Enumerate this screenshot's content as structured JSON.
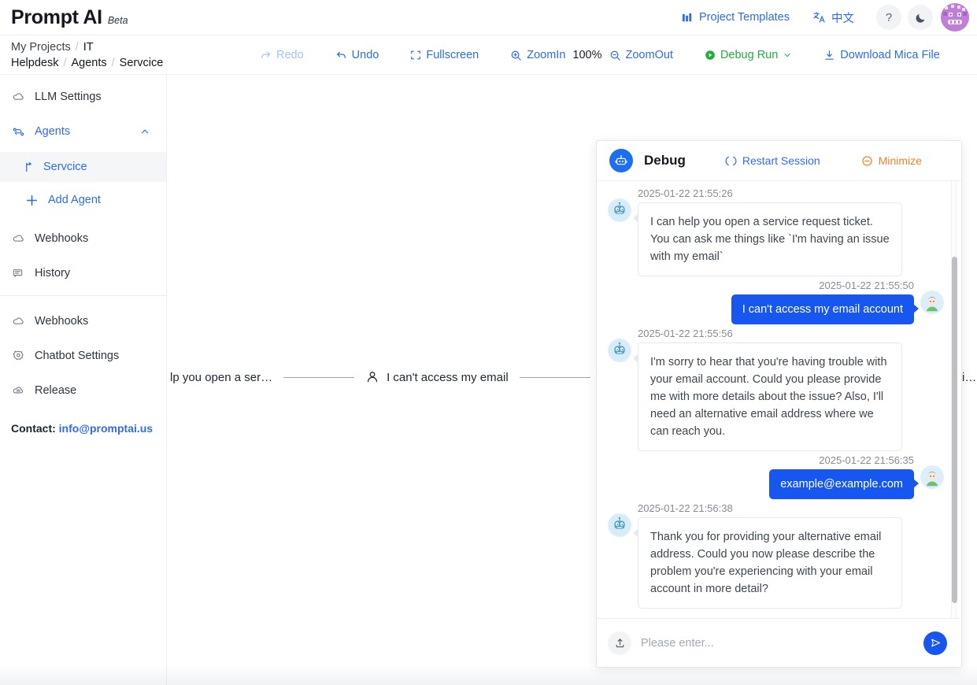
{
  "app": {
    "brand_name": "Prompt AI",
    "brand_tag": "Beta"
  },
  "topbar": {
    "project_templates": "Project Templates",
    "language": "中文",
    "help_label": "?",
    "theme_label": "dark-mode"
  },
  "breadcrumb": {
    "items": [
      "My Projects",
      "IT Helpdesk",
      "Agents",
      "Servcice"
    ],
    "separator": "/"
  },
  "toolbar": {
    "redo": "Redo",
    "undo": "Undo",
    "fullscreen": "Fullscreen",
    "zoom_in": "ZoomIn",
    "zoom_level": "100%",
    "zoom_out": "ZoomOut",
    "debug_run": "Debug Run",
    "download": "Download Mica File"
  },
  "sidebar": {
    "items": [
      {
        "label": "LLM Settings",
        "icon": "cloud-icon",
        "active": false
      },
      {
        "label": "Agents",
        "icon": "agents-icon",
        "active": true,
        "expanded": true
      }
    ],
    "agent_children": [
      {
        "label": "Servcice",
        "icon": "branch-icon",
        "selected": true
      }
    ],
    "add_agent": "Add Agent",
    "items_after": [
      {
        "label": "Webhooks",
        "icon": "cloud-icon"
      },
      {
        "label": "History",
        "icon": "history-icon"
      }
    ],
    "items_bottom": [
      {
        "label": "Webhooks",
        "icon": "cloud-icon"
      },
      {
        "label": "Chatbot Settings",
        "icon": "gear-icon"
      },
      {
        "label": "Release",
        "icon": "release-icon"
      }
    ],
    "contact_label": "Contact:",
    "contact_email": "info@promptai.us"
  },
  "canvas": {
    "nodes": [
      {
        "text": "lp you open a ser…",
        "icon": null
      },
      {
        "text": "I can't access my email",
        "icon": "person-icon"
      },
      {
        "text": "i…",
        "icon": null
      }
    ]
  },
  "debug": {
    "title": "Debug",
    "restart": "Restart Session",
    "minimize": "Minimize",
    "placeholder": "Please enter...",
    "input_value": "",
    "messages": [
      {
        "sender": "bot",
        "timestamp": "2025-01-22 21:55:26",
        "text": "I can help you open a service request ticket. You can ask me things like `I'm having an issue with my email`"
      },
      {
        "sender": "user",
        "timestamp": "2025-01-22 21:55:50",
        "text": "I can't access my email account"
      },
      {
        "sender": "bot",
        "timestamp": "2025-01-22 21:55:56",
        "text": "I'm sorry to hear that you're having trouble with your email account. Could you please provide me with more details about the issue? Also, I'll need an alternative email address where we can reach you."
      },
      {
        "sender": "user",
        "timestamp": "2025-01-22 21:56:35",
        "text": "example@example.com"
      },
      {
        "sender": "bot",
        "timestamp": "2025-01-22 21:56:38",
        "text": "Thank you for providing your alternative email address. Could you now please describe the problem you're experiencing with your email account in more detail?"
      }
    ]
  },
  "colors": {
    "accent_blue": "#2f6bed",
    "bubble_blue": "#1757f0",
    "green": "#22ad3f",
    "orange": "#f08226",
    "text_dark": "#1f2733"
  }
}
